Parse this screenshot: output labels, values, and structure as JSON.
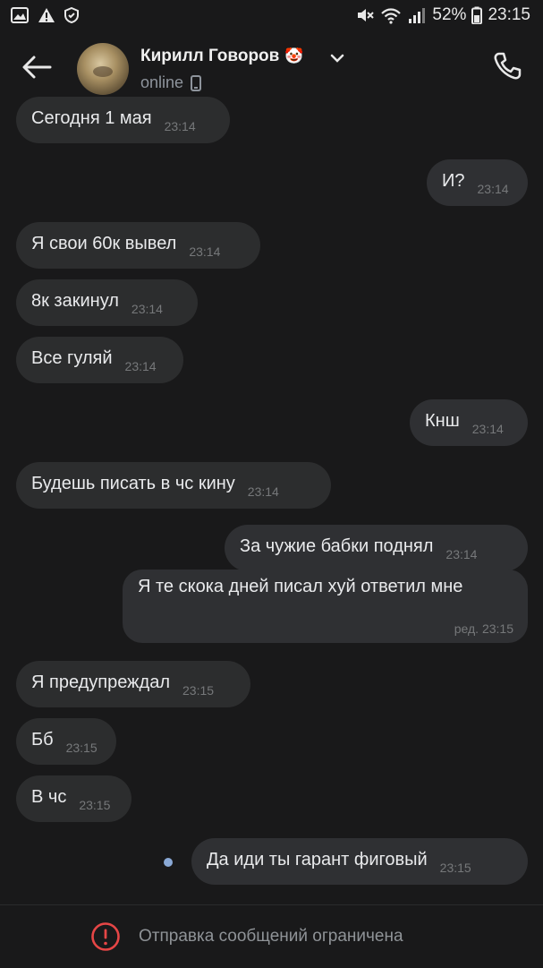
{
  "status_bar": {
    "battery": "52%",
    "time": "23:15"
  },
  "header": {
    "name": "Кирилл Говоров",
    "name_emoji": "🤡",
    "status": "online"
  },
  "messages": [
    {
      "text": "Сегодня 1 мая",
      "time": "23:14",
      "direction": "in"
    },
    {
      "text": "И?",
      "time": "23:14",
      "direction": "out"
    },
    {
      "text": "Я свои 60к вывел",
      "time": "23:14",
      "direction": "in"
    },
    {
      "text": "8к закинул",
      "time": "23:14",
      "direction": "in"
    },
    {
      "text": "Все гуляй",
      "time": "23:14",
      "direction": "in"
    },
    {
      "text": "Кнш",
      "time": "23:14",
      "direction": "out"
    },
    {
      "text": "Будешь писать в чс кину",
      "time": "23:14",
      "direction": "in"
    },
    {
      "text": "За чужие бабки поднял",
      "time": "23:14",
      "direction": "out"
    },
    {
      "text": "Я те скока дней писал хуй ответил мне",
      "time": "ред. 23:15",
      "direction": "out"
    },
    {
      "text": "Я предупреждал",
      "time": "23:15",
      "direction": "in"
    },
    {
      "text": "Бб",
      "time": "23:15",
      "direction": "in"
    },
    {
      "text": "В чс",
      "time": "23:15",
      "direction": "in"
    },
    {
      "text": "Да иди ты гарант фиговый",
      "time": "23:15",
      "direction": "out"
    }
  ],
  "footer": {
    "notice": "Отправка сообщений ограничена"
  },
  "colors": {
    "background": "#19191a",
    "bubble": "#2c2d2e",
    "warning": "#e64646",
    "unread_dot": "#8aa9d6"
  },
  "icons": [
    "image-icon",
    "alert-icon",
    "shield-icon",
    "mute-icon",
    "wifi-icon",
    "signal-icon",
    "battery-icon",
    "back-arrow-icon",
    "chevron-down-icon",
    "mobile-icon",
    "phone-icon",
    "warning-circle-icon"
  ]
}
